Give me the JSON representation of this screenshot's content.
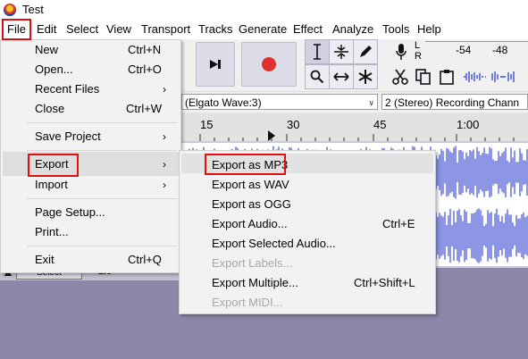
{
  "window": {
    "title": "Test"
  },
  "menubar": [
    "File",
    "Edit",
    "Select",
    "View",
    "Transport",
    "Tracks",
    "Generate",
    "Effect",
    "Analyze",
    "Tools",
    "Help"
  ],
  "meter": {
    "channels": [
      "L",
      "R"
    ],
    "ticks": [
      "-54",
      "-48"
    ]
  },
  "device": {
    "input": "(Elgato Wave:3)",
    "channels": "2 (Stereo) Recording Chann"
  },
  "ruler": [
    "15",
    "30",
    "45",
    "1:00"
  ],
  "track_controls": {
    "select_label": "Select",
    "value": "-1.0"
  },
  "file_menu": [
    {
      "label": "New",
      "shortcut": "Ctrl+N"
    },
    {
      "label": "Open...",
      "shortcut": "Ctrl+O"
    },
    {
      "label": "Recent Files",
      "submenu": true
    },
    {
      "label": "Close",
      "shortcut": "Ctrl+W"
    },
    {
      "label": "Save Project",
      "submenu": true
    },
    {
      "label": "Export",
      "submenu": true
    },
    {
      "label": "Import",
      "submenu": true
    },
    {
      "label": "Page Setup..."
    },
    {
      "label": "Print..."
    },
    {
      "label": "Exit",
      "shortcut": "Ctrl+Q"
    }
  ],
  "export_menu": [
    {
      "label": "Export as MP3",
      "enabled": true
    },
    {
      "label": "Export as WAV",
      "enabled": true
    },
    {
      "label": "Export as OGG",
      "enabled": true
    },
    {
      "label": "Export Audio...",
      "shortcut": "Ctrl+E",
      "enabled": true
    },
    {
      "label": "Export Selected Audio...",
      "enabled": true
    },
    {
      "label": "Export Labels...",
      "enabled": false
    },
    {
      "label": "Export Multiple...",
      "shortcut": "Ctrl+Shift+L",
      "enabled": true
    },
    {
      "label": "Export MIDI...",
      "enabled": false
    }
  ],
  "icons": {
    "submenu_arrow": "chevron-right-icon",
    "dropdown_arrow": "chevron-down-icon"
  },
  "colors": {
    "callout": "#e01010",
    "record": "#e03030",
    "waveform": "#3f4fd2",
    "highlight": "#dedede"
  }
}
